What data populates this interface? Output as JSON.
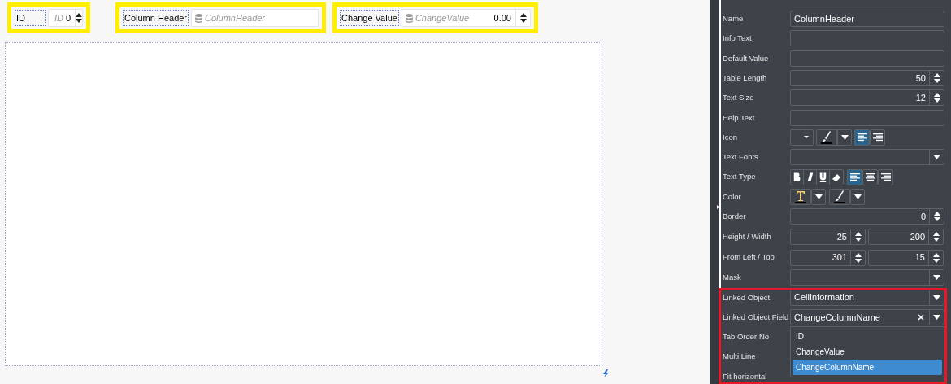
{
  "widgets": [
    {
      "kind": "number",
      "label": "ID",
      "placeholder": "ID",
      "value": "0",
      "highlighted": true
    },
    {
      "kind": "text",
      "label": "Column Header",
      "placeholder": "ColumnHeader",
      "highlighted": true
    },
    {
      "kind": "number",
      "label": "Change Value",
      "placeholder": "ChangeValue",
      "value": "0.00",
      "highlighted": true
    }
  ],
  "properties": [
    {
      "kind": "text",
      "label": "Name",
      "value": "ColumnHeader"
    },
    {
      "kind": "text",
      "label": "Info Text"
    },
    {
      "kind": "text",
      "label": "Default Value"
    },
    {
      "kind": "spinner",
      "label": "Table Length",
      "value": "50"
    },
    {
      "kind": "spinner",
      "label": "Text Size",
      "value": "12"
    },
    {
      "kind": "text",
      "label": "Help Text"
    },
    {
      "kind": "icon_tools",
      "label": "Icon",
      "align": [
        {
          "selected": true
        },
        {
          "selected": false
        }
      ]
    },
    {
      "kind": "select",
      "label": "Text Fonts"
    },
    {
      "kind": "text_type",
      "label": "Text Type",
      "align": [
        {
          "selected": true
        },
        {
          "selected": false
        },
        {
          "selected": false
        }
      ]
    },
    {
      "kind": "color",
      "label": "Color"
    },
    {
      "kind": "spinner",
      "label": "Border",
      "value": "0"
    },
    {
      "kind": "double_spinner",
      "label": "Height / Width",
      "values": [
        "25",
        "200"
      ]
    },
    {
      "kind": "double_spinner",
      "label": "From Left / Top",
      "values": [
        "301",
        "15"
      ]
    },
    {
      "kind": "select",
      "label": "Mask"
    },
    {
      "kind": "select",
      "label": "Linked Object",
      "value": "CellInformation"
    },
    {
      "kind": "combo",
      "label": "Linked Object Field",
      "value": "ChangeColumnName",
      "options": [
        {
          "label": "ID",
          "selected": false
        },
        {
          "label": "ChangeValue",
          "selected": false
        },
        {
          "label": "ChangeColumnName",
          "selected": true
        }
      ]
    },
    {
      "kind": "label",
      "label": "Tab Order No"
    },
    {
      "kind": "label",
      "label": "Multi Line"
    },
    {
      "kind": "label",
      "label": "Fit horizontal"
    }
  ],
  "linked_section": {
    "highlighted": true
  }
}
